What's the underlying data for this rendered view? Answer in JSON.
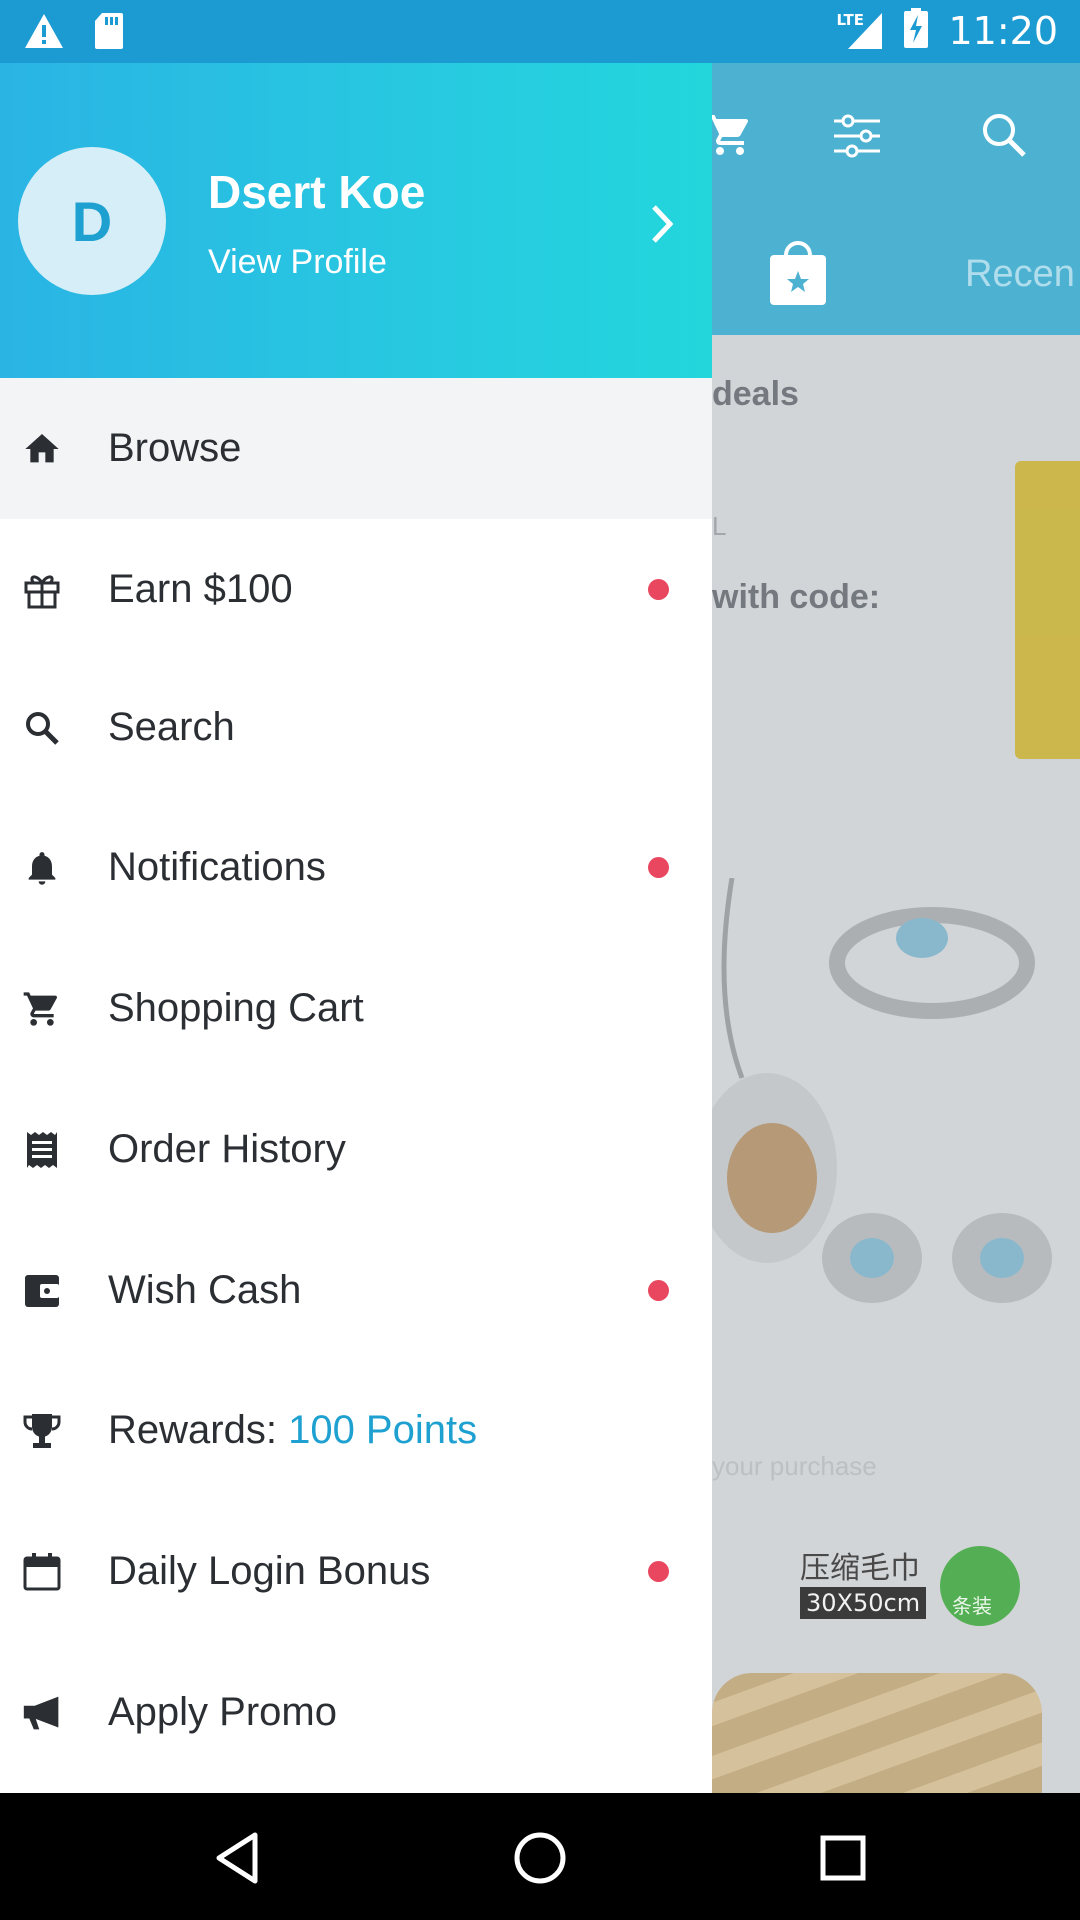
{
  "status_bar": {
    "time": "11:20",
    "network": "LTE",
    "left_icons": [
      "warning-icon",
      "sd-card-icon"
    ],
    "right_icons": [
      "lte-signal-icon",
      "battery-charging-icon"
    ]
  },
  "background_app": {
    "header_icons": [
      "cart-icon",
      "filter-icon",
      "search-icon",
      "bag-star-icon"
    ],
    "tab_partial": "Recen",
    "deals_partial": "deals",
    "l_partial": "L",
    "code_partial": "with code:",
    "purchase_partial": "your purchase",
    "towel_zh": "压缩毛巾",
    "towel_size": "30X50cm",
    "towel_badge": "条装"
  },
  "drawer": {
    "header": {
      "avatar_letter": "D",
      "name": "Dsert Koe",
      "link": "View Profile"
    },
    "items": [
      {
        "label": "Browse",
        "icon": "home-icon",
        "badge": false,
        "active": true
      },
      {
        "label": "Earn $100",
        "icon": "gift-icon",
        "badge": true
      },
      {
        "label": "Search",
        "icon": "search-icon",
        "badge": false
      },
      {
        "label": "Notifications",
        "icon": "bell-icon",
        "badge": true
      },
      {
        "label": "Shopping Cart",
        "icon": "cart-icon",
        "badge": false
      },
      {
        "label": "Order History",
        "icon": "receipt-icon",
        "badge": false
      },
      {
        "label": "Wish Cash",
        "icon": "wallet-icon",
        "badge": true
      },
      {
        "label": "Rewards:",
        "accent": "100 Points",
        "icon": "trophy-icon",
        "badge": false
      },
      {
        "label": "Daily Login Bonus",
        "icon": "calendar-icon",
        "badge": true
      },
      {
        "label": "Apply Promo",
        "icon": "megaphone-icon",
        "badge": false
      }
    ]
  },
  "nav_bar": {
    "buttons": [
      "back-icon",
      "home-icon",
      "recents-icon"
    ]
  },
  "colors": {
    "accent": "#1ea0d0",
    "badge": "#e8475f",
    "status_bar": "#1c9bd3"
  }
}
